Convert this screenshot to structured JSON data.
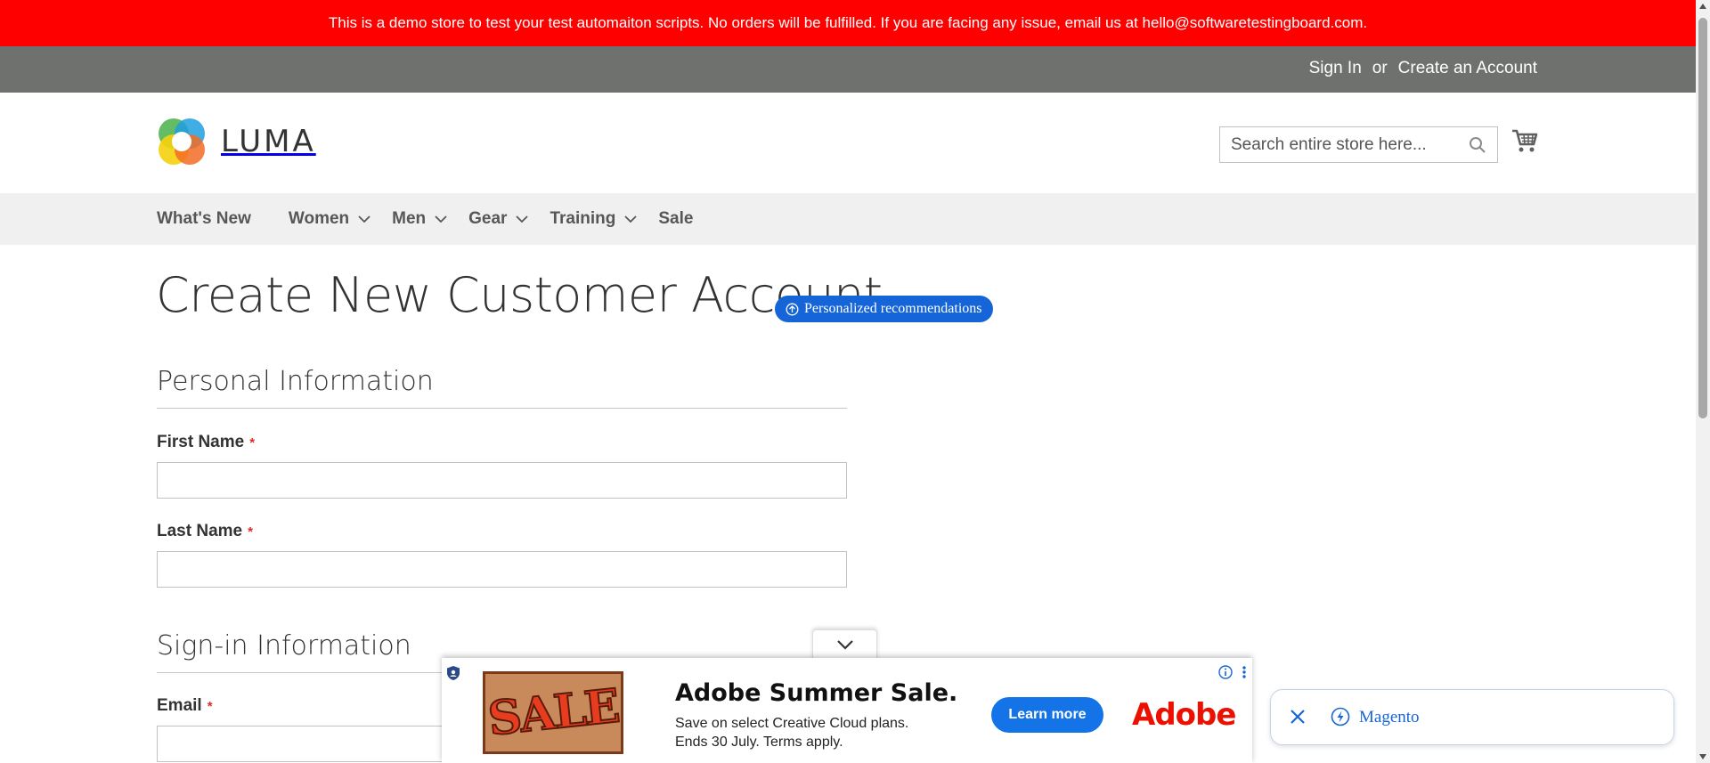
{
  "demo_banner": {
    "text": "This is a demo store to test your test automaiton scripts. No orders will be fulfilled. If you are facing any issue, email us at hello@softwaretestingboard.com."
  },
  "topbar": {
    "sign_in": "Sign In",
    "or": "or",
    "create_account": "Create an Account"
  },
  "header": {
    "logo_text": "LUMA",
    "search_placeholder": "Search entire store here...",
    "icons": {
      "search": "search-icon",
      "cart": "cart-icon"
    }
  },
  "nav": {
    "items": [
      {
        "label": "What's New",
        "has_dropdown": false
      },
      {
        "label": "Women",
        "has_dropdown": true
      },
      {
        "label": "Men",
        "has_dropdown": true
      },
      {
        "label": "Gear",
        "has_dropdown": true
      },
      {
        "label": "Training",
        "has_dropdown": true
      },
      {
        "label": "Sale",
        "has_dropdown": false
      }
    ]
  },
  "page": {
    "title": "Create New Customer Account",
    "recommendations_badge": "Personalized recommendations"
  },
  "form": {
    "personal_section": "Personal Information",
    "first_name_label": "First Name",
    "first_name_value": "",
    "last_name_label": "Last Name",
    "last_name_value": "",
    "signin_section": "Sign-in Information",
    "email_label": "Email",
    "email_value": "",
    "required_mark": "*"
  },
  "ad": {
    "image_text": "SALE",
    "headline": "Adobe Summer Sale.",
    "body": "Save on select Creative Cloud plans. Ends 30 July. Terms apply.",
    "cta": "Learn more",
    "brand": "Adobe"
  },
  "magento_pill": {
    "label": "Magento"
  },
  "colors": {
    "banner": "#ff0000",
    "topbar": "#6e716e",
    "nav_bg": "#f0f0f0",
    "required": "#e02b27",
    "accent_blue": "#1565d8",
    "adobe_red": "#eb1000"
  }
}
